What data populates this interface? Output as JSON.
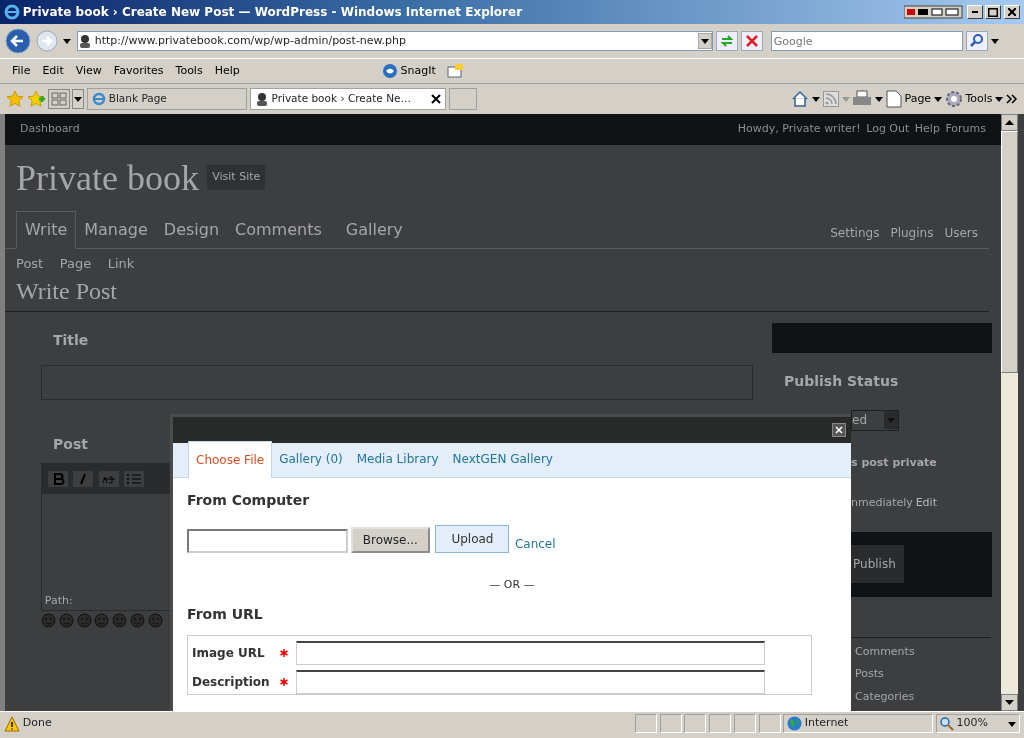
{
  "window": {
    "title": "Private book › Create New Post — WordPress - Windows Internet Explorer"
  },
  "address_bar": {
    "url": "http://www.privatebook.com/wp/wp-admin/post-new.php",
    "search_placeholder": "Google"
  },
  "menu": [
    "File",
    "Edit",
    "View",
    "Favorites",
    "Tools",
    "Help"
  ],
  "snagit": "SnagIt",
  "browser_tabs": [
    {
      "label": "Blank Page",
      "selected": false
    },
    {
      "label": "Private book › Create Ne…",
      "selected": true
    }
  ],
  "command_bar": [
    "Page",
    "Tools"
  ],
  "admin_bar": {
    "left": "Dashboard",
    "right": [
      "Howdy, Private writer!",
      "Log Out",
      "Help",
      "Forums"
    ]
  },
  "blog": {
    "title": "Private book",
    "visit": "Visit Site"
  },
  "main_menu": [
    {
      "label": "Write",
      "selected": true
    },
    {
      "label": "Manage",
      "selected": false
    },
    {
      "label": "Design",
      "selected": false
    },
    {
      "label": "Comments",
      "selected": false
    },
    {
      "label": "Gallery",
      "selected": false
    }
  ],
  "side_menu": [
    "Settings",
    "Plugins",
    "Users"
  ],
  "sub_menu": [
    "Post",
    "Page",
    "Link"
  ],
  "heading": "Write Post",
  "editor": {
    "title_label": "Title",
    "post_label": "Post",
    "path": "Path:"
  },
  "sidebar": {
    "publish_status": "Publish Status",
    "select_value": "ed",
    "private": "s post private",
    "publish_time": "nmediately",
    "edit": "Edit",
    "publish": "Publish",
    "links": [
      "Comments",
      "Posts",
      "Categories"
    ]
  },
  "modal": {
    "tabs": [
      {
        "label": "Choose File",
        "selected": true
      },
      {
        "label": "Gallery (0)",
        "selected": false
      },
      {
        "label": "Media Library",
        "selected": false
      },
      {
        "label": "NextGEN Gallery",
        "selected": false
      }
    ],
    "from_computer": "From Computer",
    "browse": "Browse...",
    "upload": "Upload",
    "cancel": "Cancel",
    "or": "— OR —",
    "from_url": "From URL",
    "fields": [
      {
        "label": "Image URL",
        "required": true
      },
      {
        "label": "Description",
        "required": true
      }
    ]
  },
  "status_bar": {
    "text": "Done",
    "zone": "Internet",
    "zoom": "100%"
  }
}
